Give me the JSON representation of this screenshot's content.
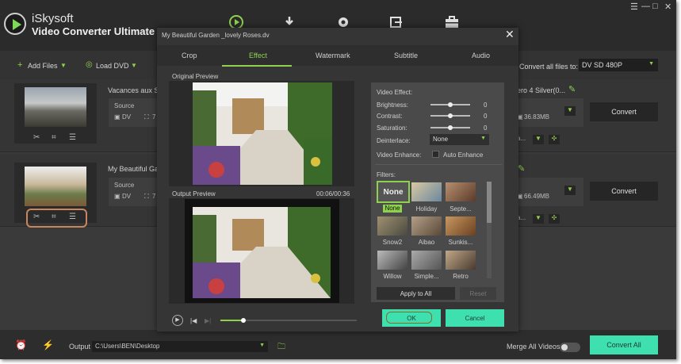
{
  "app": {
    "brand_line1": "iSkysoft",
    "brand_line2": "Video Converter Ultimate"
  },
  "toolbar": {
    "add_files": "Add Files",
    "load_dvd": "Load DVD",
    "convert_all_label": "Convert all files to:",
    "format": "DV SD 480P"
  },
  "rows": [
    {
      "title": "Vacances aux Se",
      "source": "Source",
      "format": "DV",
      "res": "7",
      "right_title": "ero 4 Silver(0...",
      "size": "36.83MB",
      "convert": "Convert"
    },
    {
      "title": "My Beautiful Gard",
      "source": "Source",
      "format": "DV",
      "res": "7",
      "size": "66.49MB",
      "convert": "Convert"
    }
  ],
  "modal": {
    "title": "My Beautiful Garden _lovely Roses.dv",
    "tabs": [
      "Crop",
      "Effect",
      "Watermark",
      "Subtitle",
      "Audio"
    ],
    "original_preview": "Original Preview",
    "output_preview": "Output Preview",
    "time": "00:06/00:36",
    "video_effect": "Video Effect:",
    "brightness": "Brightness:",
    "contrast": "Contrast:",
    "saturation": "Saturation:",
    "brightness_val": "0",
    "contrast_val": "0",
    "saturation_val": "0",
    "deinterlace": "Deinterlace:",
    "deinterlace_val": "None",
    "video_enhance": "Video Enhance:",
    "auto_enhance": "Auto Enhance",
    "filters": "Filters:",
    "filter_items": [
      "None",
      "Holiday",
      "Septe...",
      "Snow2",
      "Aibao",
      "Sunkis...",
      "Willow",
      "Simple...",
      "Retro"
    ],
    "none_thumb": "None",
    "apply_all": "Apply to All",
    "reset": "Reset",
    "ok": "OK",
    "cancel": "Cancel",
    "playback_progress": 0.17
  },
  "bottom": {
    "output_label": "Output",
    "output_path": "C:\\Users\\BEN\\Desktop",
    "merge": "Merge All Videos",
    "convert_all": "Convert All"
  },
  "colors": {
    "accent_green": "#8fd14f",
    "button_teal": "#3fe0b0"
  }
}
